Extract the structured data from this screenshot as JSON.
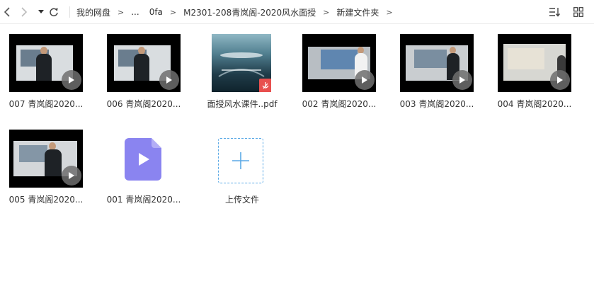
{
  "toolbar": {
    "back_icon": "chevron-left-icon",
    "forward_icon": "chevron-right-icon",
    "dropdown_icon": "caret-down-icon",
    "refresh_icon": "refresh-icon",
    "sort_icon": "sort-icon",
    "grid_icon": "grid-view-icon"
  },
  "breadcrumb": {
    "items": [
      "我的网盘",
      "...",
      "0fa",
      "M2301-208青岚阁-2020风水面授",
      "新建文件夹"
    ],
    "separator": ">"
  },
  "files": [
    {
      "name": "007 青岚阁2020...",
      "type": "video"
    },
    {
      "name": "006 青岚阁2020...",
      "type": "video"
    },
    {
      "name": "面授风水课件..pdf",
      "type": "pdf"
    },
    {
      "name": "002 青岚阁2020...",
      "type": "video"
    },
    {
      "name": "003 青岚阁2020...",
      "type": "video"
    },
    {
      "name": "004 青岚阁2020...",
      "type": "video"
    },
    {
      "name": "005 青岚阁2020...",
      "type": "video"
    },
    {
      "name": "001 青岚阁2020...",
      "type": "video-file"
    }
  ],
  "upload": {
    "label": "上传文件",
    "icon": "plus-icon"
  },
  "colors": {
    "accent": "#5aa9e6",
    "video_icon": "#8a84f0",
    "pdf_badge": "#e8504f"
  }
}
